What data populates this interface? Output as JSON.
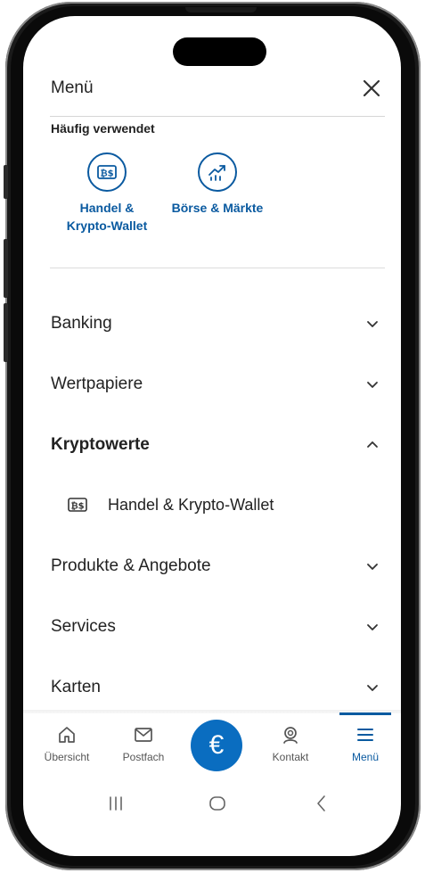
{
  "header": {
    "title": "Menü",
    "close_icon": "close-icon"
  },
  "frequently_used": {
    "label": "Häufig verwendet",
    "tiles": [
      {
        "label_line1": "Handel &",
        "label_line2": "Krypto-Wallet",
        "icon": "crypto-trade-icon"
      },
      {
        "label_line1": "Börse & Märkte",
        "label_line2": "",
        "icon": "chart-growth-icon"
      }
    ]
  },
  "menu": {
    "items": [
      {
        "label": "Banking",
        "state": "collapsed"
      },
      {
        "label": "Wertpapiere",
        "state": "collapsed"
      },
      {
        "label": "Kryptowerte",
        "state": "expanded"
      },
      {
        "label": "Produkte & Angebote",
        "state": "collapsed"
      },
      {
        "label": "Services",
        "state": "collapsed"
      },
      {
        "label": "Karten",
        "state": "collapsed"
      }
    ],
    "kryptowerte_sub": [
      {
        "label": "Handel & Krypto-Wallet",
        "icon": "crypto-trade-icon"
      }
    ]
  },
  "bottom_nav": {
    "items": [
      {
        "label": "Übersicht",
        "icon": "home-icon",
        "active": false
      },
      {
        "label": "Postfach",
        "icon": "mail-icon",
        "active": false
      },
      {
        "label": "€",
        "icon": "euro-icon",
        "active": false
      },
      {
        "label": "Kontakt",
        "icon": "headset-icon",
        "active": false
      },
      {
        "label": "Menü",
        "icon": "hamburger-icon",
        "active": true
      }
    ]
  },
  "colors": {
    "accent": "#0a5aa0",
    "fab": "#0a6dc0",
    "text": "#222222",
    "divider": "#d6d6d6"
  }
}
